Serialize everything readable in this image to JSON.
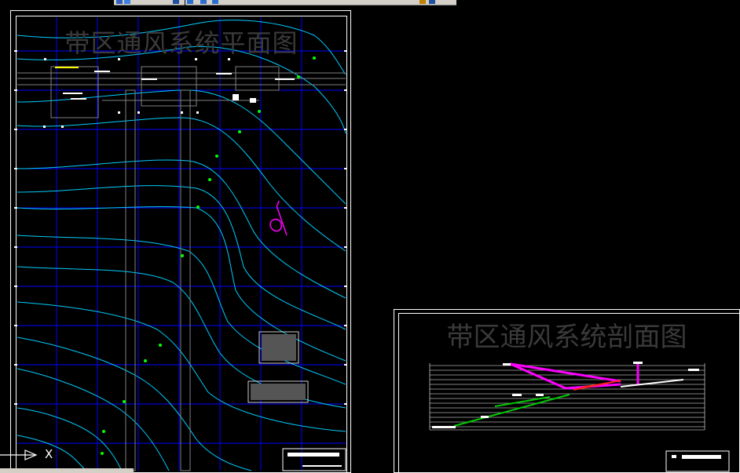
{
  "plan": {
    "title": "带区通风系统平面图"
  },
  "section": {
    "title": "带区通风系统剖面图"
  },
  "ucs": {
    "axis_label": "X"
  },
  "colors": {
    "background": "#000000",
    "grid": "#0000ff",
    "contour": "#00ccff",
    "frame": "#ffffff",
    "section_pipe": "#ff00ff",
    "section_green": "#00cc00",
    "section_red": "#ff2020"
  },
  "icons": [
    "toolbar-icon",
    "ucs-arrow-icon",
    "north-arrow-icon"
  ]
}
